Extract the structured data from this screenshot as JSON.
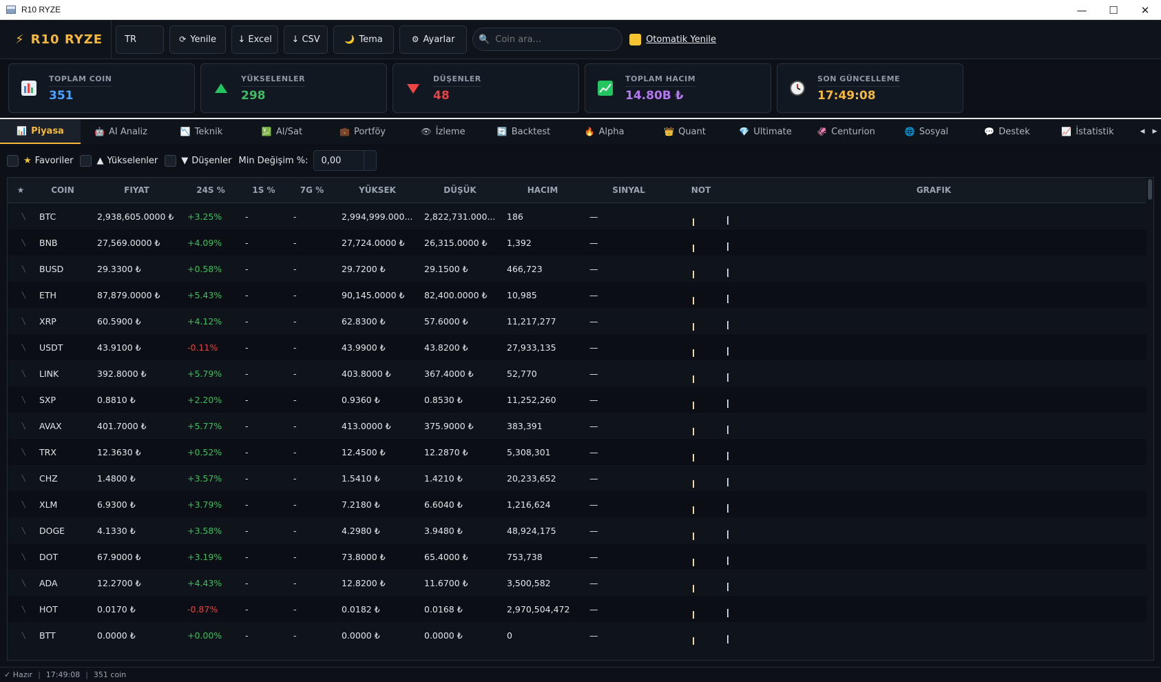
{
  "window": {
    "title": "R10 RYZE",
    "minimize": "—",
    "maximize": "☐",
    "close": "✕"
  },
  "toolbar": {
    "brand": "R10 RYZE",
    "lang": "TR",
    "refresh": "Yenile",
    "excel": "↓ Excel",
    "csv": "↓ CSV",
    "theme": "Tema",
    "settings": "Ayarlar",
    "search_placeholder": "Coin ara...",
    "auto_refresh": "Otomatik Yenile"
  },
  "cards": [
    {
      "label": "TOPLAM COIN",
      "value": "351",
      "color": "#4aa3ff",
      "icon": "bar-chart-icon"
    },
    {
      "label": "YÜKSELENLER",
      "value": "298",
      "color": "#3fbe5f",
      "icon": "up-triangle-icon"
    },
    {
      "label": "DÜŞENLER",
      "value": "48",
      "color": "#e24545",
      "icon": "down-triangle-icon"
    },
    {
      "label": "TOPLAM HACIM",
      "value": "14.80B ₺",
      "color": "#b477f0",
      "icon": "trend-chart-icon"
    },
    {
      "label": "SON GÜNCELLEME",
      "value": "17:49:08",
      "color": "#f5b83d",
      "icon": "clock-icon"
    }
  ],
  "tabs": [
    {
      "label": "Piyasa",
      "icon": "📊",
      "active": true
    },
    {
      "label": "AI Analiz",
      "icon": "🤖"
    },
    {
      "label": "Teknik",
      "icon": "📉"
    },
    {
      "label": "Al/Sat",
      "icon": "💹"
    },
    {
      "label": "Portföy",
      "icon": "💼"
    },
    {
      "label": "İzleme",
      "icon": "👁"
    },
    {
      "label": "Backtest",
      "icon": "🔄"
    },
    {
      "label": "Alpha",
      "icon": "🔥"
    },
    {
      "label": "Quant",
      "icon": "👑"
    },
    {
      "label": "Ultimate",
      "icon": "💎"
    },
    {
      "label": "Centurion",
      "icon": "🦑"
    },
    {
      "label": "Sosyal",
      "icon": "🌐"
    },
    {
      "label": "Destek",
      "icon": "💬"
    },
    {
      "label": "İstatistik",
      "icon": "📈"
    }
  ],
  "filters": {
    "favorites": "Favoriler",
    "gainers": "Yükselenler",
    "losers": "Düşenler",
    "min_change_label": "Min Değişim %:",
    "min_change_value": "0,00"
  },
  "table": {
    "headers": [
      "★",
      "COIN",
      "FIYAT",
      "24S %",
      "1S %",
      "7G %",
      "YÜKSEK",
      "DÜŞÜK",
      "HACIM",
      "SINYAL",
      "NOT",
      "GRAFIK"
    ],
    "rows": [
      {
        "coin": "BTC",
        "price": "2,938,605.0000 ₺",
        "ch24": "+3.25%",
        "h1": "-",
        "d7": "-",
        "high": "2,994,999.000...",
        "low": "2,822,731.000...",
        "vol": "186",
        "signal": "—"
      },
      {
        "coin": "BNB",
        "price": "27,569.0000 ₺",
        "ch24": "+4.09%",
        "h1": "-",
        "d7": "-",
        "high": "27,724.0000 ₺",
        "low": "26,315.0000 ₺",
        "vol": "1,392",
        "signal": "—"
      },
      {
        "coin": "BUSD",
        "price": "29.3300 ₺",
        "ch24": "+0.58%",
        "h1": "-",
        "d7": "-",
        "high": "29.7200 ₺",
        "low": "29.1500 ₺",
        "vol": "466,723",
        "signal": "—"
      },
      {
        "coin": "ETH",
        "price": "87,879.0000 ₺",
        "ch24": "+5.43%",
        "h1": "-",
        "d7": "-",
        "high": "90,145.0000 ₺",
        "low": "82,400.0000 ₺",
        "vol": "10,985",
        "signal": "—"
      },
      {
        "coin": "XRP",
        "price": "60.5900 ₺",
        "ch24": "+4.12%",
        "h1": "-",
        "d7": "-",
        "high": "62.8300 ₺",
        "low": "57.6000 ₺",
        "vol": "11,217,277",
        "signal": "—"
      },
      {
        "coin": "USDT",
        "price": "43.9100 ₺",
        "ch24": "-0.11%",
        "h1": "-",
        "d7": "-",
        "high": "43.9900 ₺",
        "low": "43.8200 ₺",
        "vol": "27,933,135",
        "signal": "—"
      },
      {
        "coin": "LINK",
        "price": "392.8000 ₺",
        "ch24": "+5.79%",
        "h1": "-",
        "d7": "-",
        "high": "403.8000 ₺",
        "low": "367.4000 ₺",
        "vol": "52,770",
        "signal": "—"
      },
      {
        "coin": "SXP",
        "price": "0.8810 ₺",
        "ch24": "+2.20%",
        "h1": "-",
        "d7": "-",
        "high": "0.9360 ₺",
        "low": "0.8530 ₺",
        "vol": "11,252,260",
        "signal": "—"
      },
      {
        "coin": "AVAX",
        "price": "401.7000 ₺",
        "ch24": "+5.77%",
        "h1": "-",
        "d7": "-",
        "high": "413.0000 ₺",
        "low": "375.9000 ₺",
        "vol": "383,391",
        "signal": "—"
      },
      {
        "coin": "TRX",
        "price": "12.3630 ₺",
        "ch24": "+0.52%",
        "h1": "-",
        "d7": "-",
        "high": "12.4500 ₺",
        "low": "12.2870 ₺",
        "vol": "5,308,301",
        "signal": "—"
      },
      {
        "coin": "CHZ",
        "price": "1.4800 ₺",
        "ch24": "+3.57%",
        "h1": "-",
        "d7": "-",
        "high": "1.5410 ₺",
        "low": "1.4210 ₺",
        "vol": "20,233,652",
        "signal": "—"
      },
      {
        "coin": "XLM",
        "price": "6.9300 ₺",
        "ch24": "+3.79%",
        "h1": "-",
        "d7": "-",
        "high": "7.2180 ₺",
        "low": "6.6040 ₺",
        "vol": "1,216,624",
        "signal": "—"
      },
      {
        "coin": "DOGE",
        "price": "4.1330 ₺",
        "ch24": "+3.58%",
        "h1": "-",
        "d7": "-",
        "high": "4.2980 ₺",
        "low": "3.9480 ₺",
        "vol": "48,924,175",
        "signal": "—"
      },
      {
        "coin": "DOT",
        "price": "67.9000 ₺",
        "ch24": "+3.19%",
        "h1": "-",
        "d7": "-",
        "high": "73.8000 ₺",
        "low": "65.4000 ₺",
        "vol": "753,738",
        "signal": "—"
      },
      {
        "coin": "ADA",
        "price": "12.2700 ₺",
        "ch24": "+4.43%",
        "h1": "-",
        "d7": "-",
        "high": "12.8200 ₺",
        "low": "11.6700 ₺",
        "vol": "3,500,582",
        "signal": "—"
      },
      {
        "coin": "HOT",
        "price": "0.0170 ₺",
        "ch24": "-0.87%",
        "h1": "-",
        "d7": "-",
        "high": "0.0182 ₺",
        "low": "0.0168 ₺",
        "vol": "2,970,504,472",
        "signal": "—"
      },
      {
        "coin": "BTT",
        "price": "0.0000 ₺",
        "ch24": "+0.00%",
        "h1": "-",
        "d7": "-",
        "high": "0.0000 ₺",
        "low": "0.0000 ₺",
        "vol": "0",
        "signal": "—"
      }
    ]
  },
  "status": {
    "ready": "✓ Hazır",
    "time": "17:49:08",
    "count": "351 coin"
  },
  "colors": {
    "accent": "#f5b83d",
    "positive": "#3fbe5f",
    "negative": "#e24545",
    "background": "#0d1117"
  }
}
